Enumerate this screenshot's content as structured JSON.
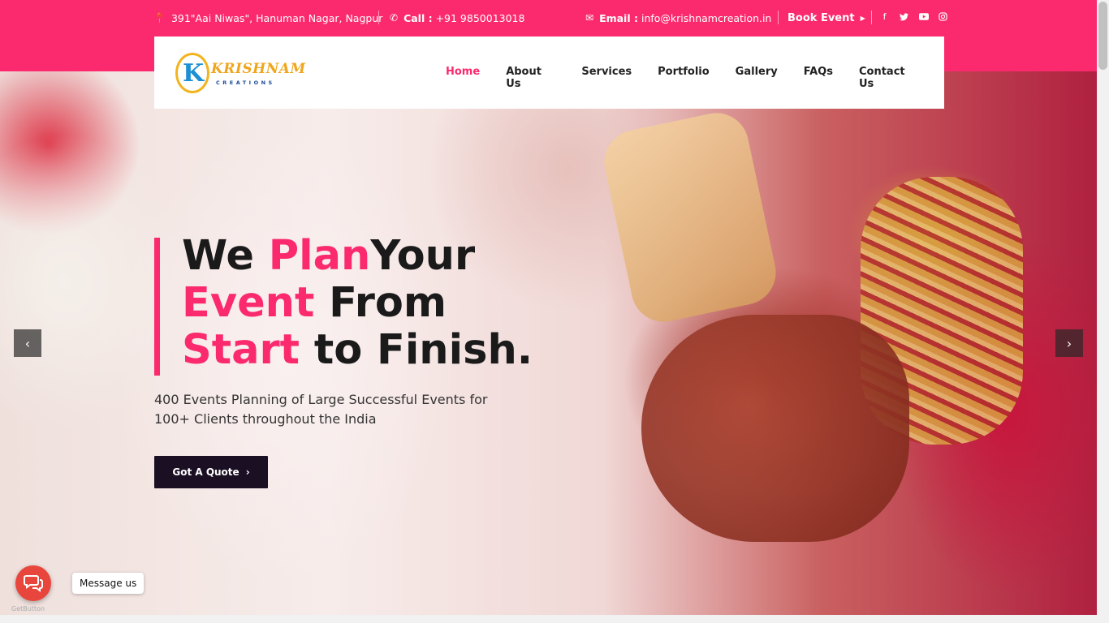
{
  "topbar": {
    "address": "391\"Aai Niwas\", Hanuman Nagar, Nagpur",
    "call_label": "Call :",
    "call_value": "+91 9850013018",
    "email_label": "Email :",
    "email_value": "info@krishnamcreation.in",
    "book_event": "Book Event",
    "social": [
      "facebook-icon",
      "twitter-icon",
      "youtube-icon",
      "instagram-icon"
    ]
  },
  "logo": {
    "initial": "K",
    "name": "KRISHNAM",
    "sub": "CREATIONS"
  },
  "menu": [
    {
      "label": "Home",
      "active": true
    },
    {
      "label": "About Us"
    },
    {
      "label": "Services"
    },
    {
      "label": "Portfolio"
    },
    {
      "label": "Gallery"
    },
    {
      "label": "FAQs"
    },
    {
      "label": "Contact Us"
    }
  ],
  "hero": {
    "line1_a": "We ",
    "line1_b": "Plan",
    "line1_c": "Your",
    "line2_a": "Event",
    "line2_b": " From",
    "line3_a": "Start",
    "line3_b": " to Finish.",
    "subtext": "400 Events Planning of Large Successful Events for 100+ Clients throughout the India",
    "button": "Got A Quote"
  },
  "chat": {
    "label": "Message us",
    "credit": "GetButton"
  },
  "colors": {
    "accent": "#fb2a6e",
    "dark": "#1b0f24"
  }
}
